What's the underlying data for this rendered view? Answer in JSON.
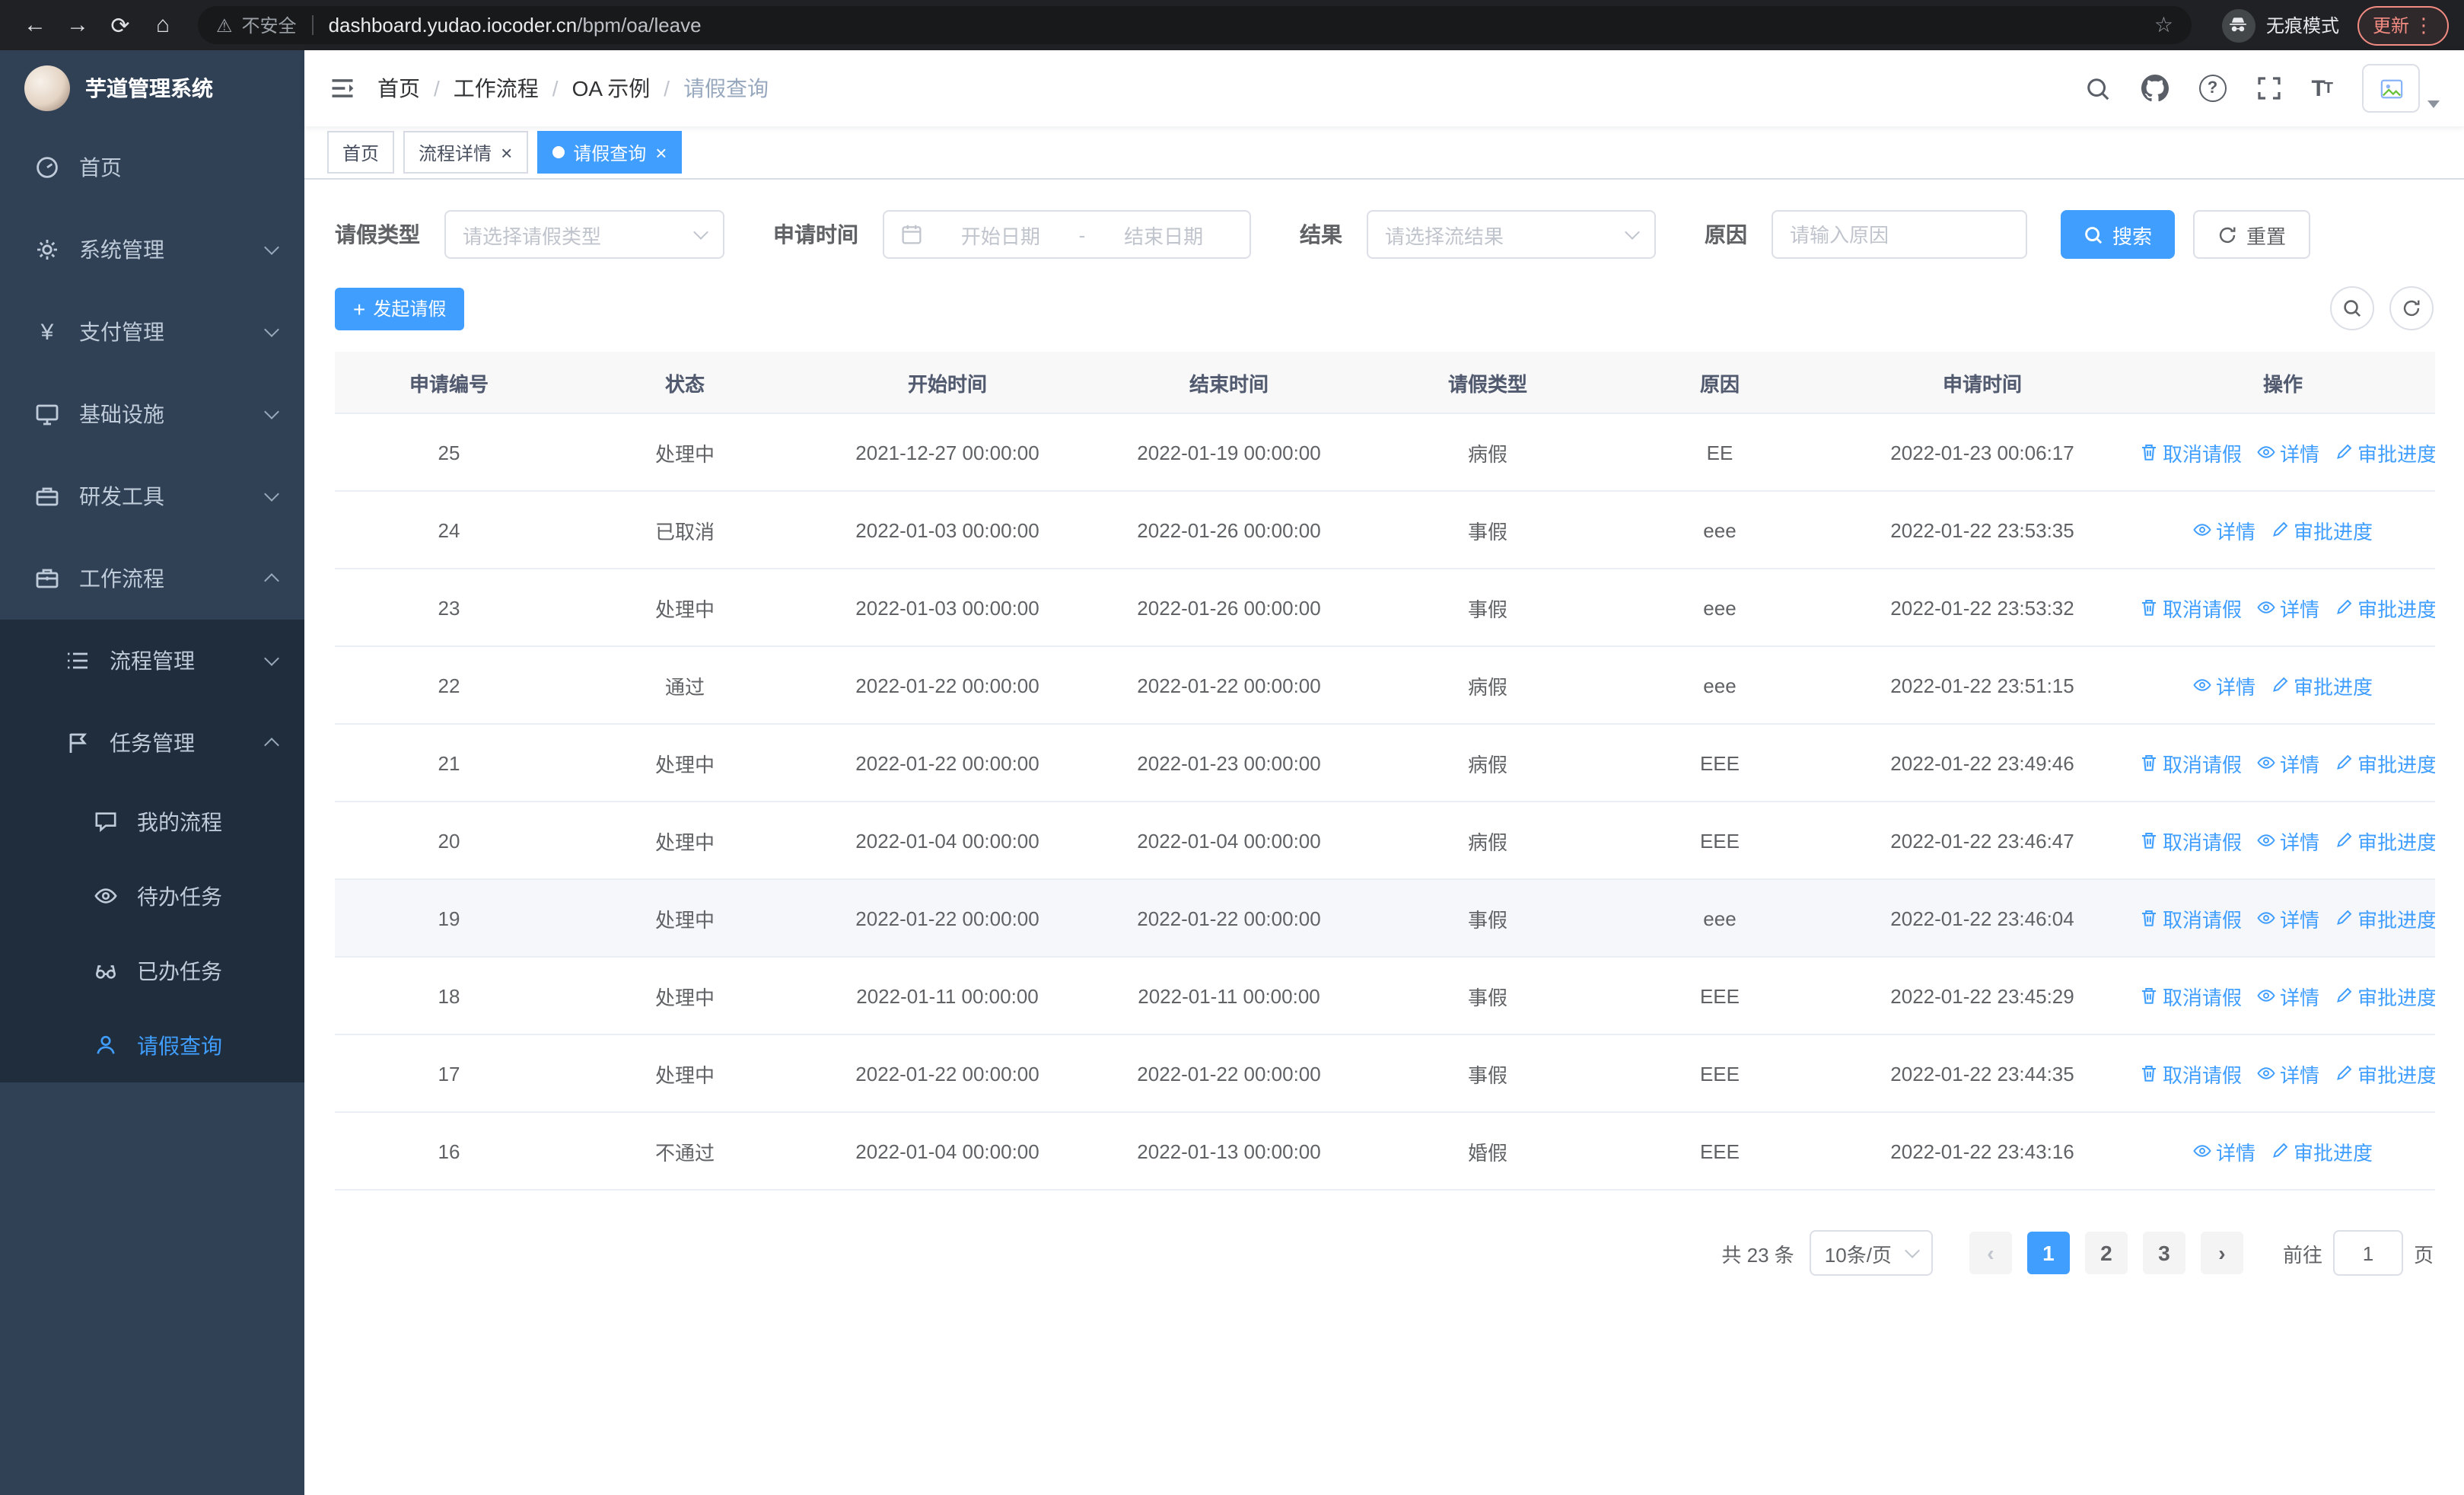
{
  "browser": {
    "security_label": "不安全",
    "url_host": "dashboard.yudao.iocoder.cn",
    "url_path": "/bpm/oa/leave",
    "incognito_label": "无痕模式",
    "update_label": "更新"
  },
  "sidebar": {
    "logo_title": "芋道管理系统",
    "items": [
      {
        "label": "首页"
      },
      {
        "label": "系统管理"
      },
      {
        "label": "支付管理"
      },
      {
        "label": "基础设施"
      },
      {
        "label": "研发工具"
      },
      {
        "label": "工作流程"
      },
      {
        "label": "流程管理"
      },
      {
        "label": "任务管理"
      },
      {
        "label": "我的流程"
      },
      {
        "label": "待办任务"
      },
      {
        "label": "已办任务"
      },
      {
        "label": "请假查询"
      }
    ]
  },
  "header": {
    "breadcrumb": [
      "首页",
      "工作流程",
      "OA 示例",
      "请假查询"
    ]
  },
  "tabs": [
    {
      "label": "首页"
    },
    {
      "label": "流程详情"
    },
    {
      "label": "请假查询"
    }
  ],
  "filters": {
    "leave_type_label": "请假类型",
    "leave_type_placeholder": "请选择请假类型",
    "apply_time_label": "申请时间",
    "start_date_placeholder": "开始日期",
    "date_separator": "-",
    "end_date_placeholder": "结束日期",
    "result_label": "结果",
    "result_placeholder": "请选择流结果",
    "reason_label": "原因",
    "reason_placeholder": "请输入原因",
    "search_button": "搜索",
    "reset_button": "重置"
  },
  "toolbar": {
    "create_button": "发起请假"
  },
  "table": {
    "columns": [
      "申请编号",
      "状态",
      "开始时间",
      "结束时间",
      "请假类型",
      "原因",
      "申请时间",
      "操作"
    ],
    "action_labels": {
      "cancel": "取消请假",
      "detail": "详情",
      "progress": "审批进度"
    },
    "rows": [
      {
        "id": "25",
        "status": "处理中",
        "start": "2021-12-27 00:00:00",
        "end": "2022-01-19 00:00:00",
        "type": "病假",
        "reason": "EE",
        "apply_time": "2022-01-23 00:06:17",
        "actions": [
          "cancel",
          "detail",
          "progress"
        ]
      },
      {
        "id": "24",
        "status": "已取消",
        "start": "2022-01-03 00:00:00",
        "end": "2022-01-26 00:00:00",
        "type": "事假",
        "reason": "eee",
        "apply_time": "2022-01-22 23:53:35",
        "actions": [
          "detail",
          "progress"
        ]
      },
      {
        "id": "23",
        "status": "处理中",
        "start": "2022-01-03 00:00:00",
        "end": "2022-01-26 00:00:00",
        "type": "事假",
        "reason": "eee",
        "apply_time": "2022-01-22 23:53:32",
        "actions": [
          "cancel",
          "detail",
          "progress"
        ]
      },
      {
        "id": "22",
        "status": "通过",
        "start": "2022-01-22 00:00:00",
        "end": "2022-01-22 00:00:00",
        "type": "病假",
        "reason": "eee",
        "apply_time": "2022-01-22 23:51:15",
        "actions": [
          "detail",
          "progress"
        ]
      },
      {
        "id": "21",
        "status": "处理中",
        "start": "2022-01-22 00:00:00",
        "end": "2022-01-23 00:00:00",
        "type": "病假",
        "reason": "EEE",
        "apply_time": "2022-01-22 23:49:46",
        "actions": [
          "cancel",
          "detail",
          "progress"
        ]
      },
      {
        "id": "20",
        "status": "处理中",
        "start": "2022-01-04 00:00:00",
        "end": "2022-01-04 00:00:00",
        "type": "病假",
        "reason": "EEE",
        "apply_time": "2022-01-22 23:46:47",
        "actions": [
          "cancel",
          "detail",
          "progress"
        ]
      },
      {
        "id": "19",
        "status": "处理中",
        "start": "2022-01-22 00:00:00",
        "end": "2022-01-22 00:00:00",
        "type": "事假",
        "reason": "eee",
        "apply_time": "2022-01-22 23:46:04",
        "actions": [
          "cancel",
          "detail",
          "progress"
        ],
        "highlight": true
      },
      {
        "id": "18",
        "status": "处理中",
        "start": "2022-01-11 00:00:00",
        "end": "2022-01-11 00:00:00",
        "type": "事假",
        "reason": "EEE",
        "apply_time": "2022-01-22 23:45:29",
        "actions": [
          "cancel",
          "detail",
          "progress"
        ]
      },
      {
        "id": "17",
        "status": "处理中",
        "start": "2022-01-22 00:00:00",
        "end": "2022-01-22 00:00:00",
        "type": "事假",
        "reason": "EEE",
        "apply_time": "2022-01-22 23:44:35",
        "actions": [
          "cancel",
          "detail",
          "progress"
        ]
      },
      {
        "id": "16",
        "status": "不通过",
        "start": "2022-01-04 00:00:00",
        "end": "2022-01-13 00:00:00",
        "type": "婚假",
        "reason": "EEE",
        "apply_time": "2022-01-22 23:43:16",
        "actions": [
          "detail",
          "progress"
        ]
      }
    ]
  },
  "pagination": {
    "total_label": "共 23 条",
    "page_size": "10条/页",
    "pages": [
      "1",
      "2",
      "3"
    ],
    "active_page": "1",
    "goto_label": "前往",
    "goto_value": "1",
    "page_unit": "页"
  },
  "colors": {
    "primary": "#409eff",
    "sidebar_bg": "#304156",
    "submenu_bg": "#1f2d3d",
    "update_accent": "#f28b82"
  }
}
